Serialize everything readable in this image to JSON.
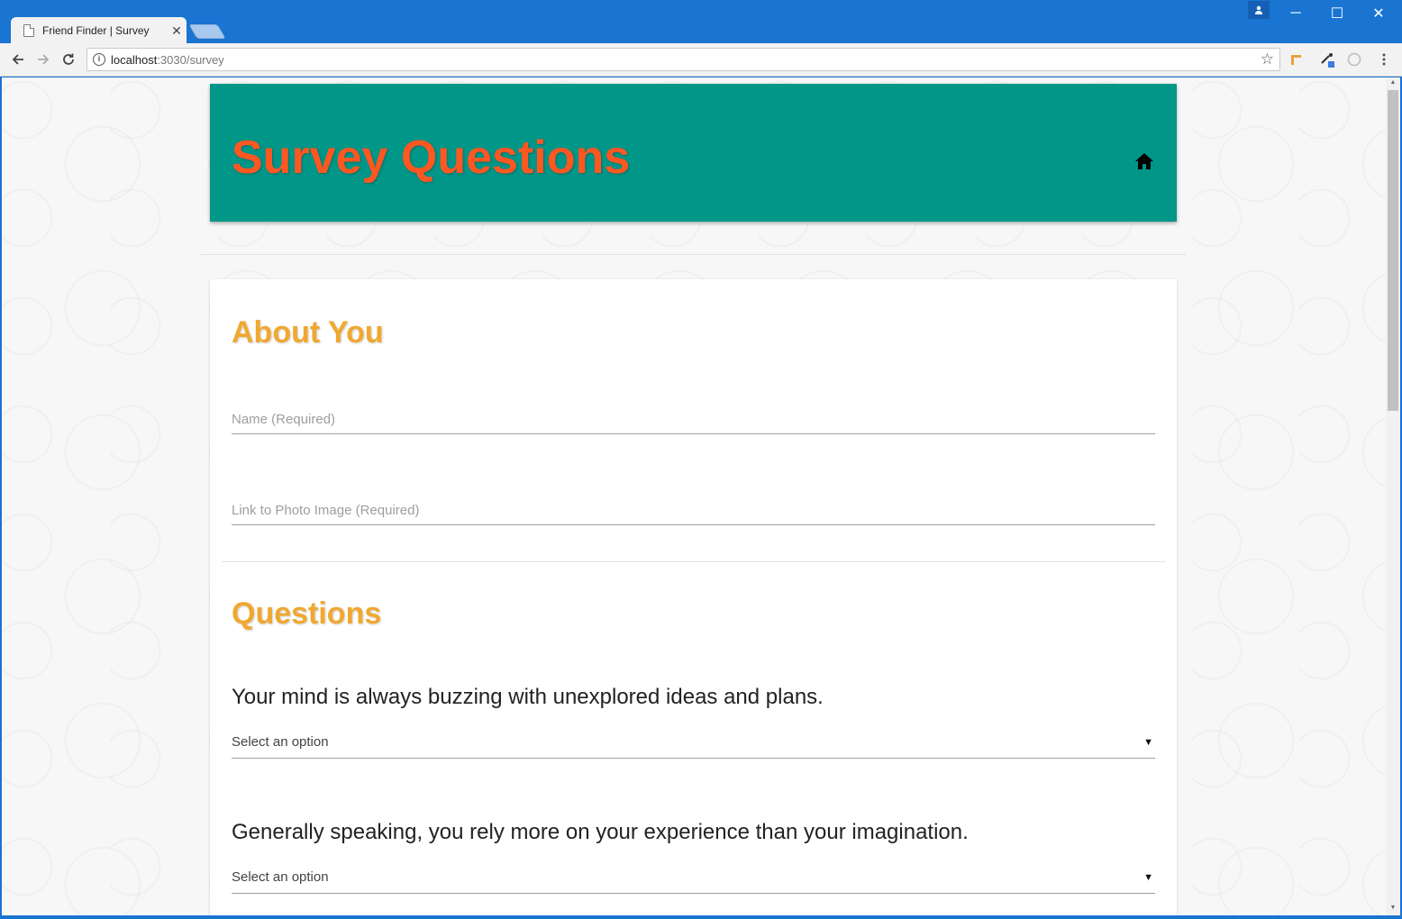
{
  "browser": {
    "tab_title": "Friend Finder | Survey",
    "tab_close": "✕",
    "url_host": "localhost",
    "url_path": ":3030/survey",
    "window_controls": {
      "minimize": "─",
      "maximize": "☐",
      "close": "✕"
    }
  },
  "header": {
    "title": "Survey Questions",
    "home_icon": "home-icon"
  },
  "about": {
    "title": "About You",
    "name_placeholder": "Name (Required)",
    "photo_placeholder": "Link to Photo Image (Required)"
  },
  "questions": {
    "title": "Questions",
    "items": [
      {
        "text": "Your mind is always buzzing with unexplored ideas and plans.",
        "selected": "Select an option"
      },
      {
        "text": "Generally speaking, you rely more on your experience than your imagination.",
        "selected": "Select an option"
      }
    ]
  },
  "colors": {
    "header_bg": "#009688",
    "header_title": "#ff5722",
    "section_title": "#f0a830",
    "chrome_blue": "#1974d2"
  }
}
